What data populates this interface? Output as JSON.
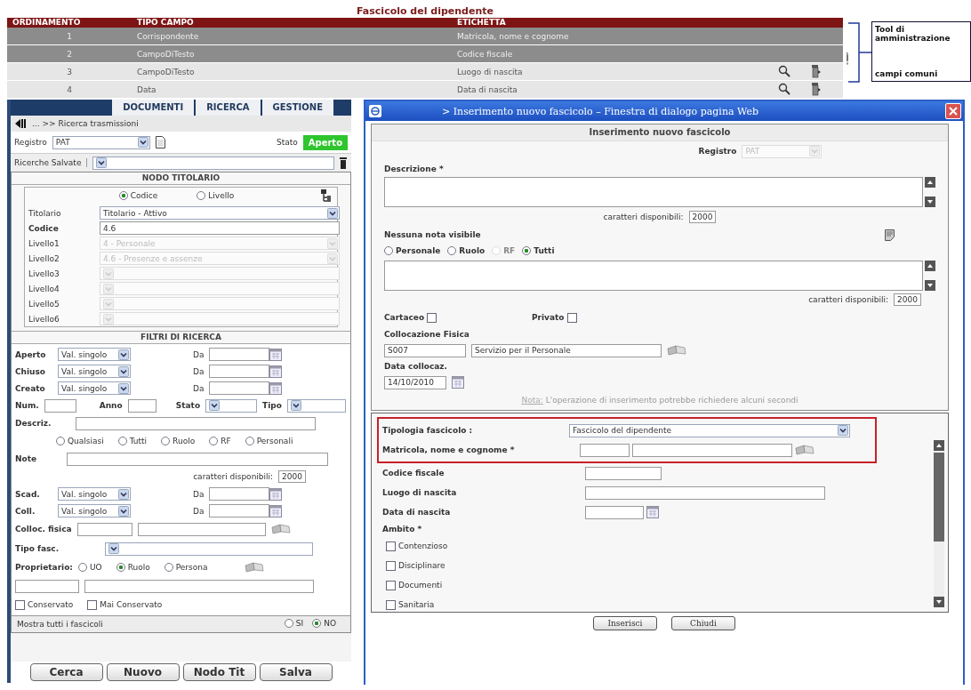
{
  "fields_table": {
    "title": "Fascicolo del dipendente",
    "columns": [
      "ORDINAMENTO",
      "TIPO CAMPO",
      "ETICHETTA"
    ],
    "rows": [
      {
        "order": "1",
        "type": "Corrispondente",
        "label": "Matricola, nome e cognome",
        "selected": true,
        "editable": false
      },
      {
        "order": "2",
        "type": "CampoDiTesto",
        "label": "Codice fiscale",
        "selected": true,
        "editable": false
      },
      {
        "order": "3",
        "type": "CampoDiTesto",
        "label": "Luogo di nascita",
        "selected": false,
        "editable": true
      },
      {
        "order": "4",
        "type": "Data",
        "label": "Data di nascita",
        "selected": false,
        "editable": true
      }
    ]
  },
  "callout": {
    "title": "Tool di amministrazione",
    "note": "campi comuni"
  },
  "search_panel": {
    "nav": [
      "DOCUMENTI",
      "RICERCA",
      "GESTIONE"
    ],
    "breadcrumb": "... >> Ricerca trasmissioni",
    "registro": {
      "label": "Registro",
      "value": "PAT"
    },
    "stato": {
      "label": "Stato",
      "value": "Aperto"
    },
    "saved": {
      "label": "Ricerche Salvate"
    },
    "node": {
      "title": "NODO TITOLARIO",
      "modes": [
        {
          "label": "Codice",
          "selected": true
        },
        {
          "label": "Livello",
          "selected": false
        }
      ],
      "fields": [
        {
          "label": "Titolario",
          "kind": "select",
          "value": "Titolario - Attivo",
          "disabled": false,
          "bold": false
        },
        {
          "label": "Codice",
          "kind": "text",
          "value": "4.6",
          "disabled": false,
          "bold": true
        },
        {
          "label": "Livello1",
          "kind": "select",
          "value": "4 - Personale",
          "disabled": true,
          "bold": false
        },
        {
          "label": "Livello2",
          "kind": "select",
          "value": "4.6 - Presenze e assenze",
          "disabled": true,
          "bold": false
        },
        {
          "label": "Livello3",
          "kind": "select",
          "disabled": true,
          "bold": false
        },
        {
          "label": "Livello4",
          "kind": "select",
          "disabled": true,
          "bold": false
        },
        {
          "label": "Livello5",
          "kind": "select",
          "disabled": true,
          "bold": false
        },
        {
          "label": "Livello6",
          "kind": "select",
          "disabled": true,
          "bold": false
        }
      ]
    },
    "filters": {
      "title": "FILTRI DI RICERCA",
      "date_filters": [
        {
          "label": "Aperto",
          "mode": "Val. singolo",
          "from": "Da"
        },
        {
          "label": "Chiuso",
          "mode": "Val. singolo",
          "from": "Da"
        },
        {
          "label": "Creato",
          "mode": "Val. singolo",
          "from": "Da"
        }
      ],
      "num": "Num.",
      "anno": "Anno",
      "stato": "Stato",
      "tipo": "Tipo",
      "descr": "Descriz.",
      "visibility": [
        {
          "label": "Qualsiasi",
          "selected": false
        },
        {
          "label": "Tutti",
          "selected": false
        },
        {
          "label": "Ruolo",
          "selected": false
        },
        {
          "label": "RF",
          "selected": false
        },
        {
          "label": "Personali",
          "selected": false
        }
      ],
      "note": "Note",
      "chars": {
        "label": "caratteri disponibili:",
        "value": "2000"
      },
      "date_filters_2": [
        {
          "label": "Scad.",
          "mode": "Val. singolo",
          "from": "Da"
        },
        {
          "label": "Coll.",
          "mode": "Val. singolo",
          "from": "Da"
        }
      ],
      "colloc": "Colloc. fisica",
      "tipo_fasc": "Tipo fasc.",
      "owner": {
        "label": "Proprietario:",
        "options": [
          {
            "label": "UO",
            "selected": false
          },
          {
            "label": "Ruolo",
            "selected": true
          },
          {
            "label": "Persona",
            "selected": false
          }
        ]
      },
      "archive": [
        {
          "label": "Conservato",
          "checked": false
        },
        {
          "label": "Mai Conservato",
          "checked": false
        }
      ]
    },
    "show_all": {
      "label": "Mostra tutti i fascicoli",
      "options": [
        {
          "label": "SI",
          "selected": false
        },
        {
          "label": "NO",
          "selected": true
        }
      ]
    },
    "buttons": [
      "Cerca",
      "Nuovo",
      "Nodo Tit",
      "Salva"
    ]
  },
  "dialog": {
    "title": "> Inserimento nuovo fascicolo – Finestra di dialogo pagina Web",
    "heading": "Inserimento nuovo fascicolo",
    "registro": {
      "label": "Registro",
      "value": "PAT",
      "disabled": true
    },
    "description": {
      "label": "Descrizione *",
      "chars_label": "caratteri disponibili:",
      "chars": "2000"
    },
    "notes": {
      "label": "Nessuna nota visibile",
      "visibility": [
        {
          "label": "Personale",
          "selected": false,
          "disabled": false
        },
        {
          "label": "Ruolo",
          "selected": false,
          "disabled": false
        },
        {
          "label": "RF",
          "selected": false,
          "disabled": true
        },
        {
          "label": "Tutti",
          "selected": true,
          "disabled": false
        }
      ],
      "chars_label": "caratteri disponibili:",
      "chars": "2000"
    },
    "flags": [
      {
        "label": "Cartaceo",
        "checked": false
      },
      {
        "label": "Privato",
        "checked": false
      }
    ],
    "location": {
      "label": "Collocazione Fisica",
      "code": "S007",
      "name": "Servizio per il Personale"
    },
    "date": {
      "label": "Data collocaz.",
      "value": "14/10/2010"
    },
    "notice": {
      "label": "Nota:",
      "text": "L'operazione di inserimento potrebbe richiedere alcuni secondi"
    },
    "custom": {
      "type": {
        "label": "Tipologia fascicolo :",
        "value": "Fascicolo del dipendente"
      },
      "fields": [
        {
          "label": "Matricola, nome e cognome *",
          "kind": "person"
        },
        {
          "label": "Codice fiscale",
          "kind": "short"
        },
        {
          "label": "Luogo di nascita",
          "kind": "long"
        },
        {
          "label": "Data di nascita",
          "kind": "date"
        }
      ],
      "scope": {
        "label": "Ambito *",
        "options": [
          {
            "label": "Contenzioso",
            "checked": false
          },
          {
            "label": "Disciplinare",
            "checked": false
          },
          {
            "label": "Documenti",
            "checked": false
          },
          {
            "label": "Sanitaria",
            "checked": false
          }
        ]
      }
    },
    "buttons": [
      "Inserisci",
      "Chiudi"
    ]
  }
}
